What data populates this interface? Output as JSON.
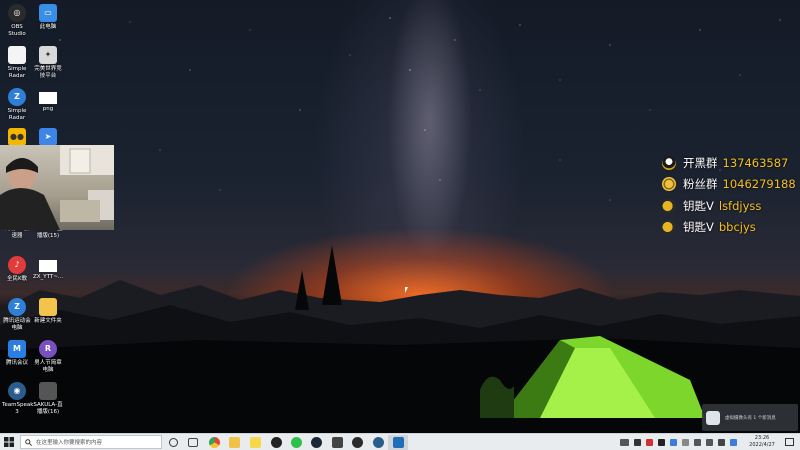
{
  "desktop_icons": [
    {
      "label": "OBS Studio",
      "icon": "obs-icon",
      "color": "#2b2b2b"
    },
    {
      "label": "此电脑",
      "icon": "computer-icon",
      "color": "#3a8ee6"
    },
    {
      "label": "Simple Radar",
      "icon": "file-icon",
      "color": "#f4f4f4"
    },
    {
      "label": "完美世界竞技平台",
      "icon": "perfectworld-icon",
      "color": "#d9d9d9"
    },
    {
      "label": "Simple Radar",
      "icon": "zip-icon",
      "color": "#2f7fd8"
    },
    {
      "label": "png",
      "icon": "image-file-icon",
      "color": "#ffffff"
    },
    {
      "label": "",
      "icon": "owl-icon",
      "color": "#f5b600"
    },
    {
      "label": "",
      "icon": "bird-icon",
      "color": "#3d86e8"
    },
    {
      "label": "网易UU加速器",
      "icon": "uu-icon",
      "color": "#3a3a3a"
    },
    {
      "label": "SAKULA-直播版(15)",
      "icon": "sakula-icon",
      "color": "#555555"
    },
    {
      "label": "全民K歌",
      "icon": "ksong-icon",
      "color": "#e23b3b"
    },
    {
      "label": "ZX_YTT~...",
      "icon": "blank-file-icon",
      "color": "#ffffff"
    },
    {
      "label": "腾讯运动会电脑",
      "icon": "zip-icon",
      "color": "#2f7fd8"
    },
    {
      "label": "新建文件夹",
      "icon": "folder-icon",
      "color": "#f3c44d"
    },
    {
      "label": "腾讯会议",
      "icon": "tencent-meeting-icon",
      "color": "#2a7de1"
    },
    {
      "label": "男人节简章电脑",
      "icon": "rar-icon",
      "color": "#7a4fbf"
    },
    {
      "label": "TeamSpeak 3",
      "icon": "teamspeak-icon",
      "color": "#2b5d8c"
    },
    {
      "label": "SAKULA-直播版(16)",
      "icon": "sakula-icon",
      "color": "#555555"
    }
  ],
  "overlay": [
    {
      "label": "开黑群",
      "value": "137463587",
      "icon": "qq-penguin-icon",
      "icon_color": "#f2f2f2"
    },
    {
      "label": "粉丝群",
      "value": "1046279188",
      "icon": "fan-group-icon",
      "icon_color": "#f0c040"
    },
    {
      "label": "钥匙V",
      "value": "lsfdjyss",
      "icon": "weibo-icon",
      "icon_color": "#e6b422"
    },
    {
      "label": "钥匙V",
      "value": "bbcjys",
      "icon": "weibo-icon",
      "icon_color": "#e6b422"
    }
  ],
  "toast": {
    "text": "虚拟摄像头有 1 个新消息"
  },
  "taskbar": {
    "search_placeholder": "在这里输入你要搜索的内容",
    "apps": [
      {
        "icon": "cortana-icon",
        "color": "#333333"
      },
      {
        "icon": "task-view-icon",
        "color": "#444444"
      },
      {
        "icon": "chrome-icon",
        "color": "#e0453a"
      },
      {
        "icon": "file-explorer-icon",
        "color": "#f1c24a"
      },
      {
        "icon": "sticky-notes-icon",
        "color": "#f6d84a"
      },
      {
        "icon": "qq-icon",
        "color": "#222222"
      },
      {
        "icon": "wechat-icon",
        "color": "#2fbf4b"
      },
      {
        "icon": "steam-icon",
        "color": "#1b2838"
      },
      {
        "icon": "game-icon",
        "color": "#444444"
      },
      {
        "icon": "obs-icon",
        "color": "#2b2b2b"
      },
      {
        "icon": "teamspeak-icon",
        "color": "#2b5d8c"
      },
      {
        "icon": "app-icon",
        "color": "#1e6fb8"
      }
    ],
    "clock_time": "23:26",
    "clock_date": "2022/4/27"
  }
}
